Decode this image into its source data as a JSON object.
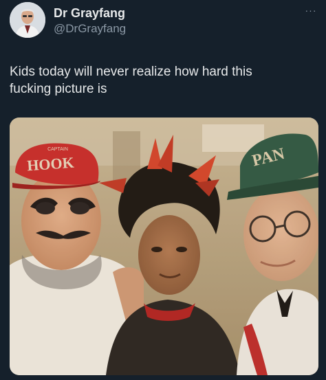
{
  "author": {
    "display_name": "Dr Grayfang",
    "handle": "@DrGrayfang",
    "avatar_icon": "doctor-portrait-avatar"
  },
  "menu": {
    "more_label": "···"
  },
  "tweet": {
    "text": "Kids today will never realize how hard this fucking picture is"
  },
  "photo": {
    "hat_left_text": "HOOK",
    "hat_left_top_text": "CAPTAIN",
    "hat_right_text": "PAN"
  },
  "colors": {
    "background": "#15202b",
    "text_primary": "#e7e9ea",
    "text_secondary": "#8b98a5"
  }
}
